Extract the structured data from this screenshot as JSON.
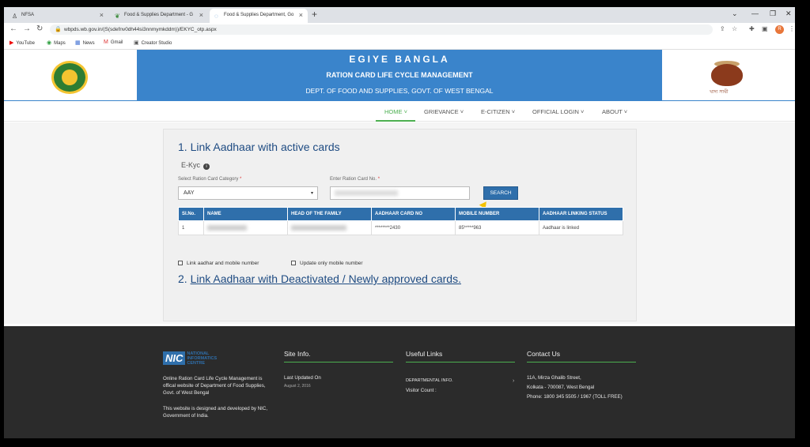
{
  "browser": {
    "tabs": [
      {
        "label": "NFSA",
        "favicon": "person-icon"
      },
      {
        "label": "Food & Supplies Department - G",
        "favicon": "leaf-icon"
      },
      {
        "label": "Food & Supplies Department, Go",
        "favicon": "loading-icon"
      }
    ],
    "new_tab": "+",
    "url": "wbpds.wb.gov.in/(S(sdefnv0dh44si3nnmymkddm))/EKYC_otp.aspx",
    "avatar": "R",
    "bookmarks": [
      {
        "label": "YouTube",
        "icon": "youtube-icon"
      },
      {
        "label": "Maps",
        "icon": "maps-icon"
      },
      {
        "label": "News",
        "icon": "news-icon"
      },
      {
        "label": "Gmail",
        "icon": "gmail-icon"
      },
      {
        "label": "Creator Studio",
        "icon": "creator-studio-icon"
      }
    ]
  },
  "header": {
    "title": "EGIYE BANGLA",
    "subtitle": "RATION CARD LIFE CYCLE MANAGEMENT",
    "dept": "DEPT. OF FOOD AND SUPPLIES, GOVT. OF WEST BENGAL",
    "pot_text": "খাদ্য সাথী",
    "brand_color": "#3a84cb"
  },
  "nav": {
    "items": [
      {
        "label": "HOME"
      },
      {
        "label": "GRIEVANCE"
      },
      {
        "label": "E-CITIZEN"
      },
      {
        "label": "OFFICIAL LOGIN"
      },
      {
        "label": "ABOUT"
      }
    ],
    "active_color": "#4caf50"
  },
  "main": {
    "heading1": "1. Link Aadhaar with active cards",
    "ekyc_label": "E-Kyc",
    "category_label": "Select Ration Card Category",
    "category_value": "AAY",
    "rcno_label": "Enter Ration Card No.",
    "required_mark": "*",
    "search_button": "SEARCH",
    "table": {
      "headers": [
        "Sl.No.",
        "NAME",
        "HEAD OF THE FAMILY",
        "AADHAAR CARD NO",
        "MOBILE NUMBER",
        "AADHAAR LINKING STATUS"
      ],
      "rows": [
        {
          "sl": "1",
          "aadhaar": "********2430",
          "mobile": "85*****963",
          "status": "Aadhaar is linked"
        }
      ]
    },
    "checkbox1": "Link aadhar and mobile number",
    "checkbox2": "Update only mobile number",
    "heading2_prefix": "2.",
    "heading2_link": "Link Aadhaar with Deactivated / Newly approved cards."
  },
  "footer": {
    "nic_logo": "NIC",
    "nic_full": [
      "NATIONAL",
      "INFORMATICS",
      "CENTRE"
    ],
    "desc1": "Online Ration Card Life Cycle Management is offical website of Department of Food Supplies, Govt. of West Bengal",
    "desc2": "This website is designed and developed by NIC, Government of India.",
    "site_info_title": "Site Info.",
    "last_updated_label": "Last Updated On",
    "last_updated_date": "August 2, 2016",
    "useful_links_title": "Useful Links",
    "departmental_info": "DEPARTMENTAL INFO.",
    "visitor_count": "Visitor Count :",
    "contact_title": "Contact Us",
    "address1": "11A, Mirza Ghalib Street,",
    "address2": "Kolkata - 700087, West Bengal",
    "phone": "Phone: 1800 345 5505 / 1967 (TOLL FREE)"
  }
}
